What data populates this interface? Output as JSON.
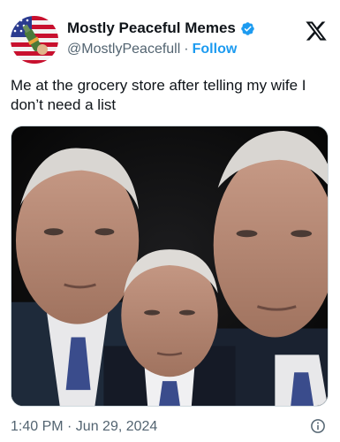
{
  "tweet": {
    "author": {
      "display_name": "Mostly Peaceful Memes",
      "handle": "@MostlyPeacefull",
      "separator": "·",
      "follow_label": "Follow",
      "verified": true
    },
    "text": "Me at the grocery store after telling my wife I don’t need a list",
    "timestamp": "1:40 PM · Jun 29, 2024",
    "media": {
      "icon": "meme-photo"
    }
  },
  "colors": {
    "link": "#1d9bf0",
    "secondary_text": "#536471",
    "primary_text": "#0f1419",
    "verified": "#1d9bf0"
  }
}
